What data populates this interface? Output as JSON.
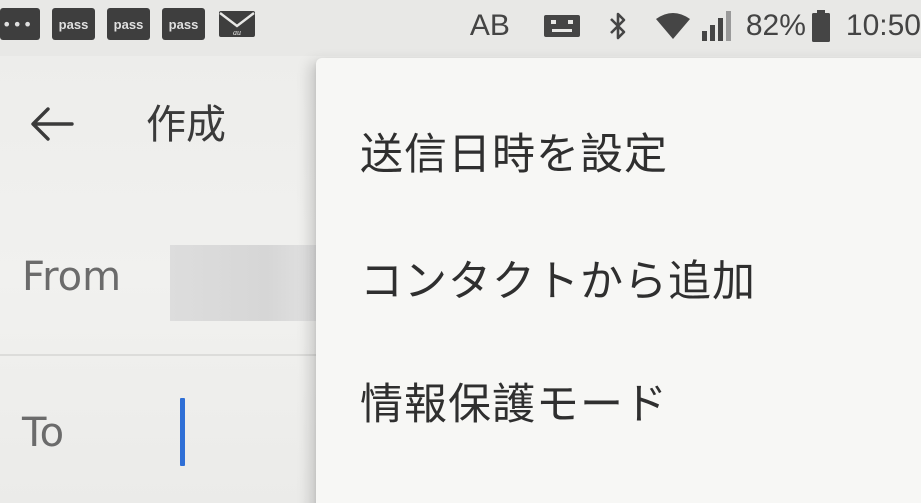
{
  "status_bar": {
    "more_glyph": "•••",
    "pass_icons": [
      "pass",
      "pass",
      "pass"
    ],
    "mail_label": "au",
    "ab": "AB",
    "battery": "82%",
    "time": "10:50"
  },
  "app_bar": {
    "title": "作成"
  },
  "form": {
    "from_label": "From",
    "to_label": "To",
    "to_value": ""
  },
  "menu": {
    "items": [
      "送信日時を設定",
      "コンタクトから追加",
      "情報保護モード"
    ]
  },
  "colors": {
    "accent": "#2f6fd6",
    "text_primary": "#2f2f2f",
    "text_secondary": "#6b6b6b"
  }
}
